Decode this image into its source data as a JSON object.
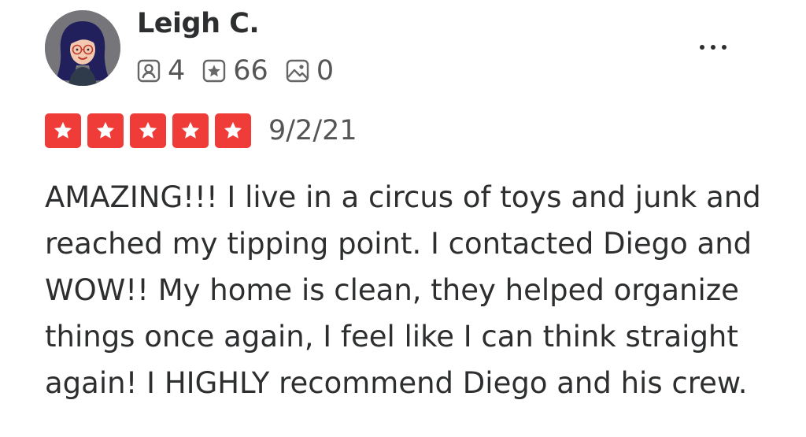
{
  "reviewer": {
    "name": "Leigh C.",
    "avatar_icon": "avatar-cartoon-woman-icon",
    "stats": [
      {
        "icon": "friends-icon",
        "value": "4"
      },
      {
        "icon": "reviews-star-icon",
        "value": "66"
      },
      {
        "icon": "photos-icon",
        "value": "0"
      }
    ]
  },
  "more_menu_icon": "more-options-icon",
  "rating": {
    "stars": 5,
    "max": 5,
    "color": "#f03c38",
    "date": "9/2/21"
  },
  "review_text": "AMAZING!!! I live in a circus of toys and junk and reached my tipping point. I contacted Diego and WOW!! My home is clean, they helped organize things once again, I feel like I can think straight again! I HIGHLY recommend Diego and his crew."
}
